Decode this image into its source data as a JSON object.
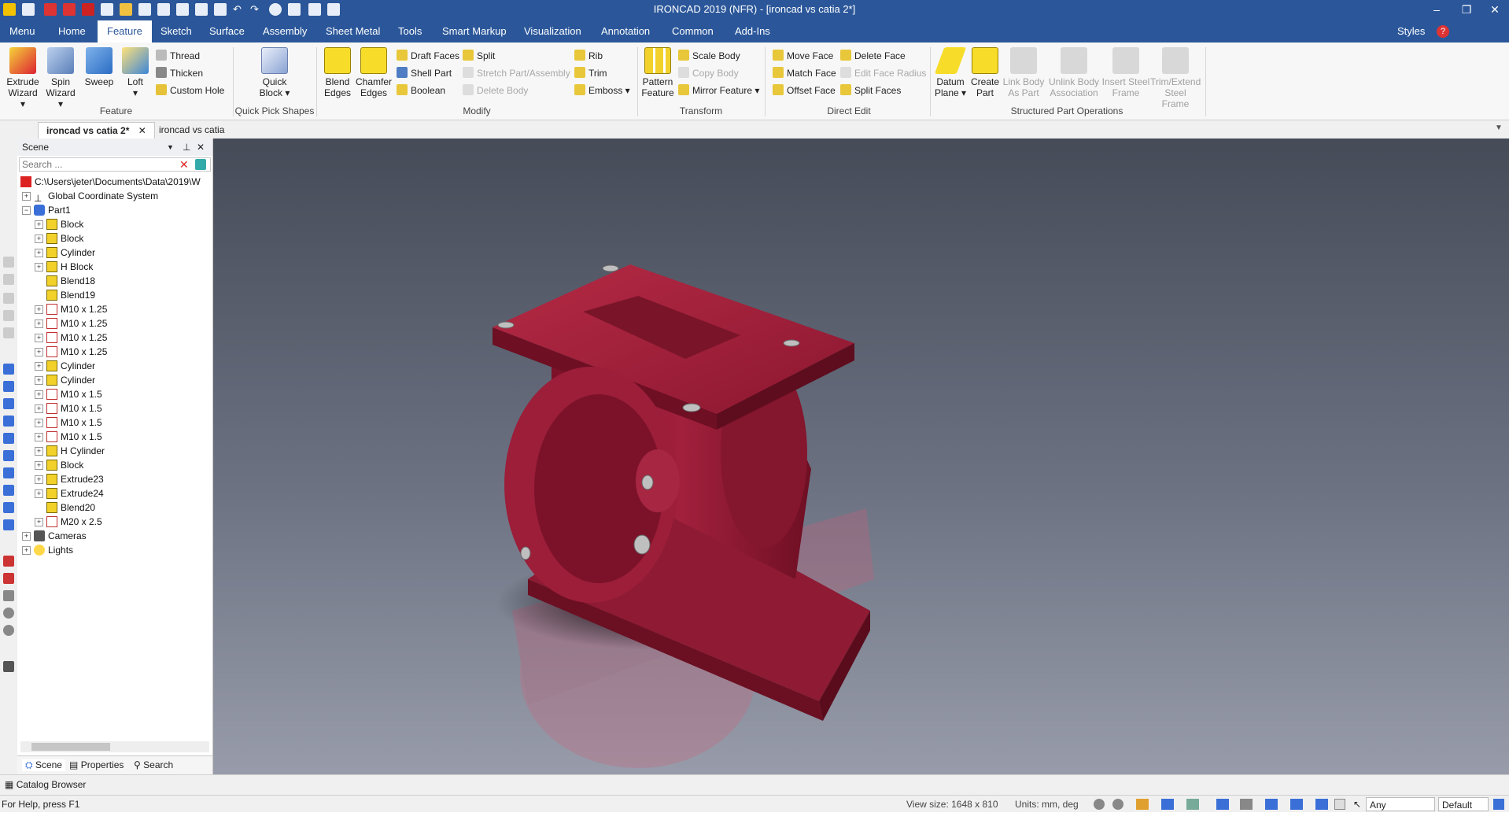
{
  "window": {
    "title": "IRONCAD 2019 (NFR) - [ironcad vs catia 2*]",
    "controls": [
      "–",
      "❐",
      "✕"
    ]
  },
  "menu_tabs": [
    "Menu",
    "Home",
    "Feature",
    "Sketch",
    "Surface",
    "Assembly",
    "Sheet Metal",
    "Tools",
    "Smart Markup",
    "Visualization",
    "Annotation",
    "Common",
    "Add-Ins"
  ],
  "active_tab": "Feature",
  "styles_label": "Styles",
  "ribbon": {
    "feature_group": {
      "label": "Feature",
      "extrude": [
        "Extrude",
        "Wizard ▾"
      ],
      "spin": [
        "Spin",
        "Wizard ▾"
      ],
      "sweep": "Sweep",
      "loft": [
        "Loft",
        "▾"
      ],
      "thread": "Thread",
      "thicken": "Thicken",
      "custom_hole": "Custom Hole"
    },
    "quick_pick": {
      "label": "Quick Pick Shapes",
      "quick_block": [
        "Quick",
        "Block ▾"
      ]
    },
    "modify": {
      "label": "Modify",
      "blend": [
        "Blend",
        "Edges"
      ],
      "chamfer": [
        "Chamfer",
        "Edges"
      ],
      "draft_faces": "Draft Faces",
      "shell_part": "Shell Part",
      "boolean": "Boolean",
      "split": "Split",
      "stretch": "Stretch Part/Assembly",
      "delete_body": "Delete Body",
      "rib": "Rib",
      "trim": "Trim",
      "emboss": "Emboss ▾"
    },
    "transform": {
      "label": "Transform",
      "pattern": [
        "Pattern",
        "Feature"
      ],
      "scale_body": "Scale Body",
      "copy_body": "Copy Body",
      "mirror_feature": "Mirror Feature ▾"
    },
    "direct_edit": {
      "label": "Direct Edit",
      "move_face": "Move Face",
      "match_face": "Match Face",
      "offset_face": "Offset Face",
      "delete_face": "Delete Face",
      "edit_face_radius": "Edit Face Radius",
      "split_faces": "Split Faces"
    },
    "structured": {
      "label": "Structured Part Operations",
      "datum_plane": [
        "Datum",
        "Plane ▾"
      ],
      "create_part": [
        "Create",
        "Part"
      ],
      "link_body": [
        "Link Body",
        "As Part"
      ],
      "unlink_body": [
        "Unlink Body",
        "Association"
      ],
      "insert_steel": [
        "Insert Steel",
        "Frame"
      ],
      "trim_extend": [
        "Trim/Extend",
        "Steel Frame"
      ]
    }
  },
  "doc_tabs": [
    "ironcad vs catia 2*",
    "ironcad vs catia"
  ],
  "scene_panel": {
    "title": "Scene",
    "search_placeholder": "Search ...",
    "root_path": "C:\\Users\\jeter\\Documents\\Data\\2019\\W",
    "items": [
      {
        "label": "Global Coordinate System",
        "level": 1,
        "icon": "csys",
        "exp": "+"
      },
      {
        "label": "Part1",
        "level": 1,
        "icon": "part",
        "exp": "-"
      },
      {
        "label": "Block",
        "level": 2,
        "icon": "feat",
        "exp": "+"
      },
      {
        "label": "Block",
        "level": 2,
        "icon": "feat",
        "exp": "+"
      },
      {
        "label": "Cylinder",
        "level": 2,
        "icon": "feat",
        "exp": "+"
      },
      {
        "label": "H Block",
        "level": 2,
        "icon": "feat",
        "exp": "+"
      },
      {
        "label": "Blend18",
        "level": 2,
        "icon": "feat",
        "exp": ""
      },
      {
        "label": "Blend19",
        "level": 2,
        "icon": "feat",
        "exp": ""
      },
      {
        "label": "M10 x 1.25",
        "level": 2,
        "icon": "hole",
        "exp": "+"
      },
      {
        "label": "M10 x 1.25",
        "level": 2,
        "icon": "hole",
        "exp": "+"
      },
      {
        "label": "M10 x 1.25",
        "level": 2,
        "icon": "hole",
        "exp": "+"
      },
      {
        "label": "M10 x 1.25",
        "level": 2,
        "icon": "hole",
        "exp": "+"
      },
      {
        "label": "Cylinder",
        "level": 2,
        "icon": "feat",
        "exp": "+"
      },
      {
        "label": "Cylinder",
        "level": 2,
        "icon": "feat",
        "exp": "+"
      },
      {
        "label": "M10 x 1.5",
        "level": 2,
        "icon": "hole",
        "exp": "+"
      },
      {
        "label": "M10 x 1.5",
        "level": 2,
        "icon": "hole",
        "exp": "+"
      },
      {
        "label": "M10 x 1.5",
        "level": 2,
        "icon": "hole",
        "exp": "+"
      },
      {
        "label": "M10 x 1.5",
        "level": 2,
        "icon": "hole",
        "exp": "+"
      },
      {
        "label": "H Cylinder",
        "level": 2,
        "icon": "feat",
        "exp": "+"
      },
      {
        "label": "Block",
        "level": 2,
        "icon": "feat",
        "exp": "+"
      },
      {
        "label": "Extrude23",
        "level": 2,
        "icon": "feat",
        "exp": "+"
      },
      {
        "label": "Extrude24",
        "level": 2,
        "icon": "feat",
        "exp": "+"
      },
      {
        "label": "Blend20",
        "level": 2,
        "icon": "feat",
        "exp": ""
      },
      {
        "label": "M20 x 2.5",
        "level": 2,
        "icon": "hole",
        "exp": "+"
      },
      {
        "label": "Cameras",
        "level": 1,
        "icon": "cam",
        "exp": "+"
      },
      {
        "label": "Lights",
        "level": 1,
        "icon": "light",
        "exp": "+"
      }
    ],
    "bottom_tabs": [
      "Scene",
      "Properties",
      "Search"
    ]
  },
  "catalog_browser": "Catalog Browser",
  "status": {
    "help": "For Help, press F1",
    "view_size": "View size: 1648 x 810",
    "units": "Units: mm, deg",
    "filter": "Any",
    "style": "Default"
  },
  "colors": {
    "accent": "#2b579a",
    "part": "#9b1c35"
  }
}
